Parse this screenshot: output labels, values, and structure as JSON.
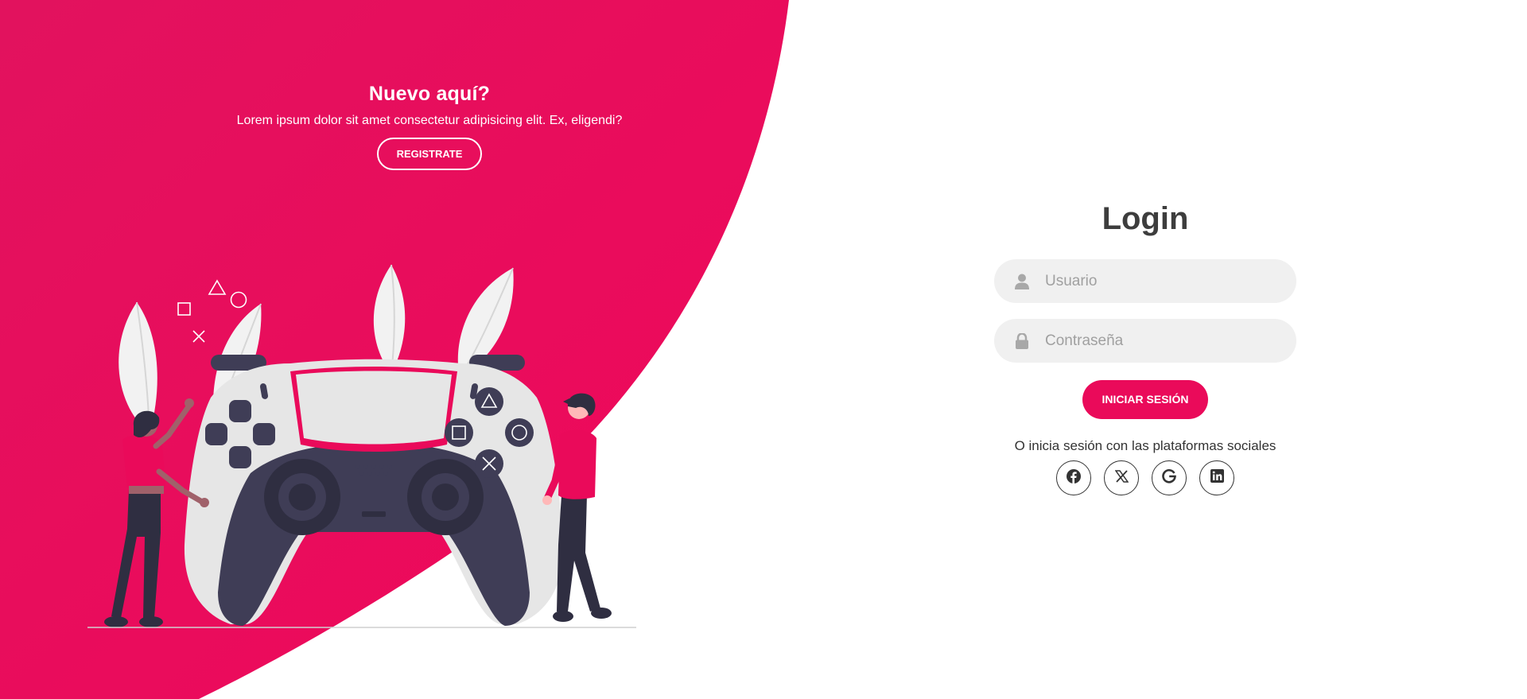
{
  "colors": {
    "accent": "#ea0a5a",
    "panel_dark": "#3f3d56",
    "controller_light": "#e6e6e6",
    "text_dark": "#3d3d3d"
  },
  "left_panel": {
    "title": "Nuevo aquí?",
    "text": "Lorem ipsum dolor sit amet consectetur adipisicing elit. Ex, eligendi?",
    "register_button": "REGISTRATE"
  },
  "login": {
    "title": "Login",
    "username": {
      "placeholder": "Usuario",
      "value": "",
      "icon": "user-icon"
    },
    "password": {
      "placeholder": "Contraseña",
      "value": "",
      "icon": "lock-icon"
    },
    "submit_button": "INICIAR SESIÓN",
    "social_text": "O inicia sesión con las plataformas sociales",
    "social": [
      {
        "icon": "facebook-icon"
      },
      {
        "icon": "x-icon"
      },
      {
        "icon": "google-icon"
      },
      {
        "icon": "linkedin-icon"
      }
    ]
  }
}
